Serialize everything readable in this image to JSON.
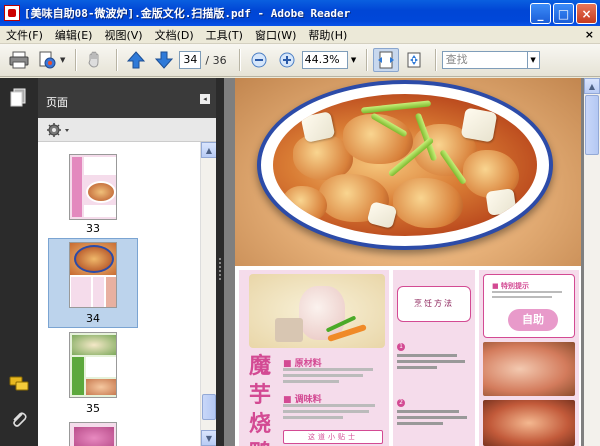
{
  "window": {
    "title": "[美味自助08-微波炉].金版文化.扫描版.pdf - Adobe Reader",
    "minimize": "_",
    "maximize": "□",
    "close": "×"
  },
  "menu": {
    "items": [
      {
        "label": "文件(F)"
      },
      {
        "label": "编辑(E)"
      },
      {
        "label": "视图(V)"
      },
      {
        "label": "文档(D)"
      },
      {
        "label": "工具(T)"
      },
      {
        "label": "窗口(W)"
      },
      {
        "label": "帮助(H)"
      }
    ],
    "close_doc": "×"
  },
  "toolbar": {
    "current_page": "34",
    "total_pages": "/ 36",
    "zoom": "44.3%",
    "find_placeholder": "查找"
  },
  "panel": {
    "title": "页面",
    "collapse": "◂",
    "thumbnails": [
      {
        "label": "33"
      },
      {
        "label": "34"
      },
      {
        "label": "35"
      }
    ]
  },
  "page_content": {
    "vertical_title": "魔芋烧鸭",
    "ingredients_title": "■ 原材料",
    "seasonings_title": "■ 调味料",
    "tip_box": "这道小贴士",
    "method_title": "烹饪方法",
    "feature_title": "■ 特别提示",
    "self_badge": "自助"
  },
  "colors": {
    "accent_pink": "#D34A93",
    "title_blue": "#0046D5",
    "plate_blue": "#2C4BA8"
  }
}
